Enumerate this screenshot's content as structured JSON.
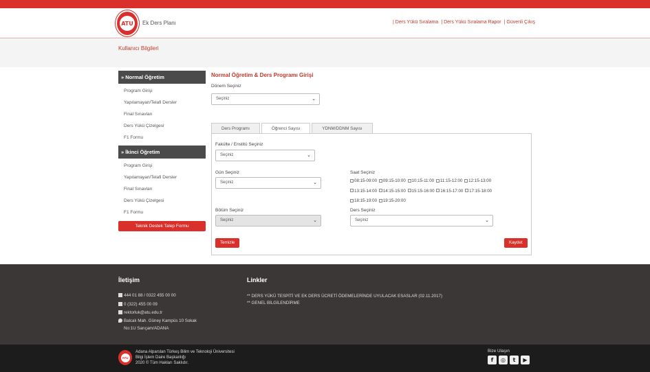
{
  "header": {
    "logo_text": "ATU",
    "app_name": "Ek Ders Planı",
    "nav": [
      "| Ders Yükü Sıralama",
      "| Ders Yükü Sıralama Rapor",
      "| Güvenli Çıkış"
    ]
  },
  "banner": {
    "title": "Kullanıcı Bilgileri"
  },
  "sidebar": {
    "normal": {
      "title": "» Normal Öğretim",
      "items": [
        "Program Girişi",
        "Yapılamayan/Telafi Dersler",
        "Final Sınavları",
        "Ders Yükü Çizelgesi",
        "F1 Formu"
      ]
    },
    "ikinci": {
      "title": "» İkinci Öğretim",
      "items": [
        "Program Girişi",
        "Yapılamayan/Telafi Dersler",
        "Final Sınavları",
        "Ders Yükü Çizelgesi",
        "F1 Formu"
      ]
    },
    "support_button": "Teknik Destek Talep Formu"
  },
  "main": {
    "title": "Normal Öğretim & Ders Programı Girişi",
    "donem_label": "Dönem Seçiniz",
    "donem_value": "Seçiniz",
    "tabs": [
      "Ders Programı",
      "Öğrenci Sayısı",
      "YDNM/DDNM Sayısı"
    ],
    "fakulte_label": "Fakülte / Enstitü Seçiniz",
    "fakulte_value": "Seçiniz",
    "gun_label": "Gün Seçiniz",
    "gun_value": "Seçiniz",
    "saat_label": "Saat Seçiniz",
    "slots": [
      "08:15-09:00",
      "09:15-10:00",
      "10:15-11:00",
      "11:15-12:00",
      "12:15-13:00",
      "13:15-14:00",
      "14:15-15:00",
      "15:15-16:00",
      "16:15-17:00",
      "17:15-18:00",
      "18:15-19:00",
      "19:15-20:00"
    ],
    "bolum_label": "Bölüm Seçiniz",
    "bolum_value": "Seçiniz",
    "ders_label": "Ders Seçiniz",
    "ders_value": "Seçiniz",
    "clear_button": "Temizle",
    "save_button": "Kaydet"
  },
  "footer": {
    "contact_title": "İletişim",
    "phone1": "444 01 88  / 0322 455 00 00",
    "fax": "0 (322) 455 00 09",
    "email": "rektorluk@atu.edu.tr",
    "address1": "Balcalı Mah. Güney Kampüs 10 Sokak",
    "address2": "No:1U Sarıçam/ADANA",
    "links_title": "Linkler",
    "links": [
      "** DERS YÜKÜ TESPİTİ VE EK DERS ÜCRETİ ÖDEMELERİNDE UYULACAK ESASLAR (02.11.2017)",
      "** GENEL BİLGİLENDİRME"
    ]
  },
  "bottom": {
    "logo_text": "ATU",
    "line1": "Adana Alparslan Türkeş Bilim ve Teknoloji Üniversitesi",
    "line2": "Bilgi İşlem Daire Başkanlığı",
    "line3": "2020 © Tüm Hakları Saklıdır.",
    "social_label": "Bize Ulaşın",
    "social_icons": [
      "f",
      "◎",
      "t",
      "▶"
    ]
  }
}
